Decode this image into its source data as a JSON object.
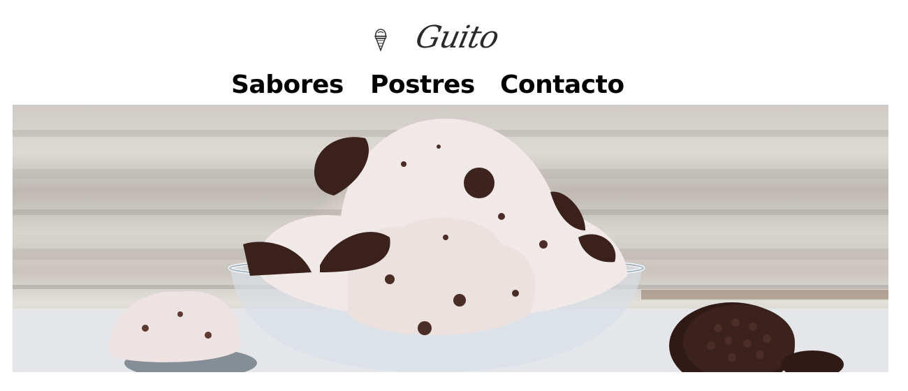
{
  "brand": {
    "name": "Guito",
    "icon": "ice-cream-cone-icon"
  },
  "nav": {
    "items": [
      {
        "label": "Sabores"
      },
      {
        "label": "Postres"
      },
      {
        "label": "Contacto"
      }
    ]
  },
  "hero": {
    "image": "cookies-and-cream ice cream in a glass bowl with chocolate sandwich cookies"
  },
  "colors": {
    "text": "#000000",
    "background": "#ffffff",
    "cookie": "#3a211c",
    "cream": "#f1e9e8"
  }
}
